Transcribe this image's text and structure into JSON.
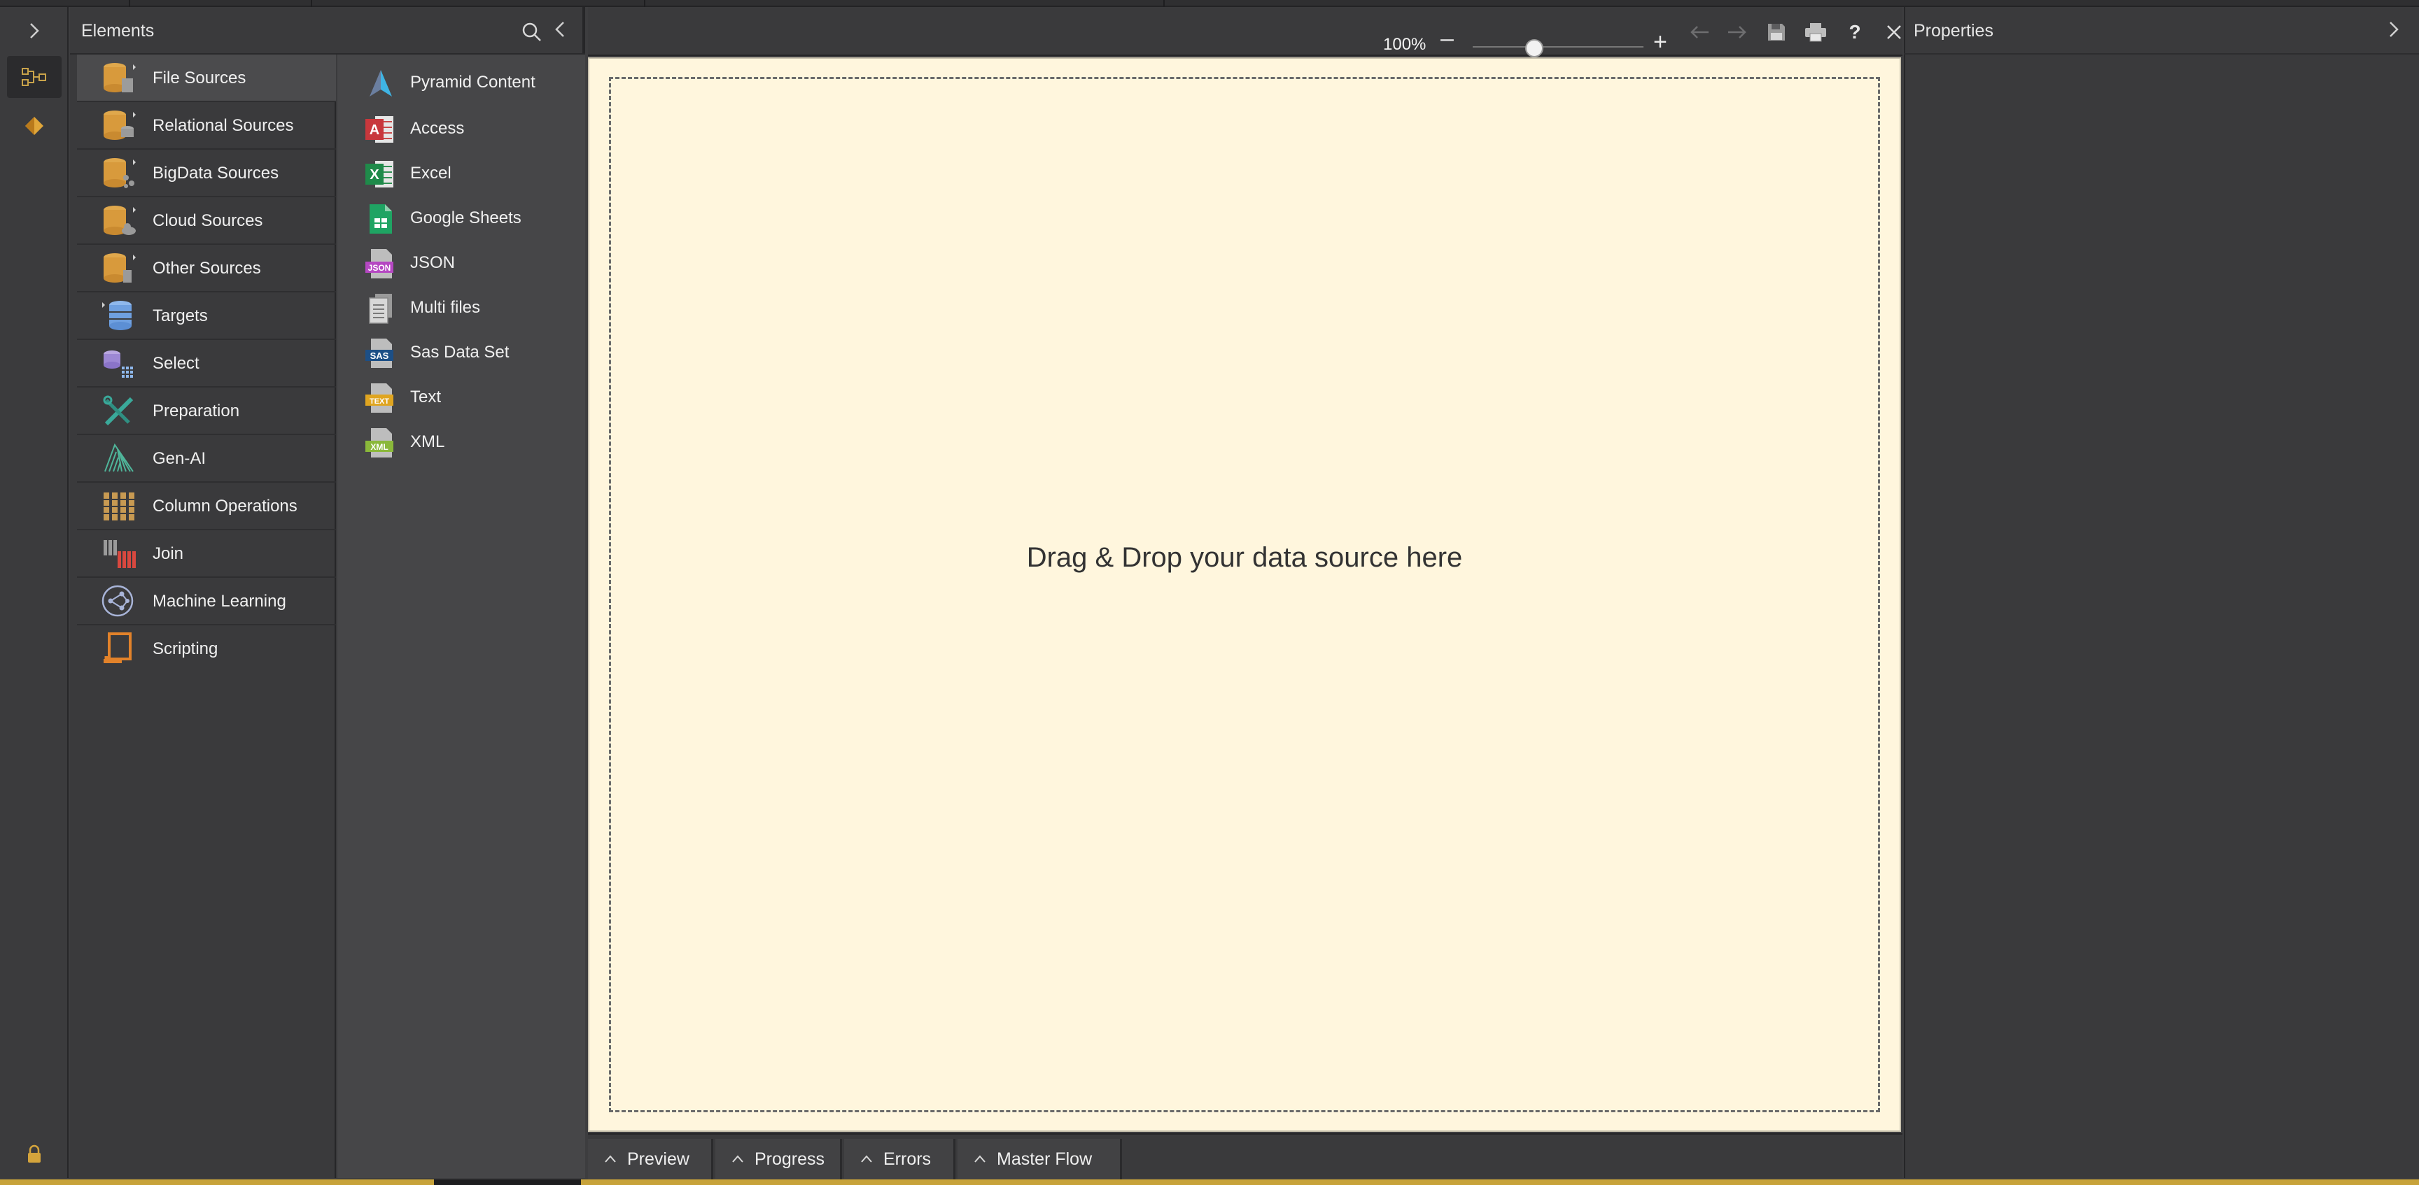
{
  "elements_panel": {
    "title": "Elements",
    "categories": [
      {
        "label": "File Sources",
        "icon": "db-file-icon"
      },
      {
        "label": "Relational Sources",
        "icon": "db-relational-icon"
      },
      {
        "label": "BigData Sources",
        "icon": "db-bigdata-icon"
      },
      {
        "label": "Cloud Sources",
        "icon": "db-cloud-icon"
      },
      {
        "label": "Other Sources",
        "icon": "db-other-icon"
      },
      {
        "label": "Targets",
        "icon": "targets-icon"
      },
      {
        "label": "Select",
        "icon": "select-icon"
      },
      {
        "label": "Preparation",
        "icon": "preparation-icon"
      },
      {
        "label": "Gen-AI",
        "icon": "gen-ai-icon"
      },
      {
        "label": "Column Operations",
        "icon": "column-operations-icon"
      },
      {
        "label": "Join",
        "icon": "join-icon"
      },
      {
        "label": "Machine Learning",
        "icon": "machine-learning-icon"
      },
      {
        "label": "Scripting",
        "icon": "scripting-icon"
      }
    ],
    "sources": [
      {
        "label": "Pyramid Content",
        "icon": "pyramid-icon"
      },
      {
        "label": "Access",
        "icon": "access-icon"
      },
      {
        "label": "Excel",
        "icon": "excel-icon"
      },
      {
        "label": "Google Sheets",
        "icon": "google-sheets-icon"
      },
      {
        "label": "JSON",
        "icon": "json-file-icon"
      },
      {
        "label": "Multi files",
        "icon": "multi-files-icon"
      },
      {
        "label": "Sas Data Set",
        "icon": "sas-file-icon"
      },
      {
        "label": "Text",
        "icon": "text-file-icon"
      },
      {
        "label": "XML",
        "icon": "xml-file-icon"
      }
    ]
  },
  "toolbar": {
    "zoom_level": "100%",
    "zoom_fraction": 0.36,
    "zoom_minus": "–",
    "zoom_plus": "+",
    "help": "?"
  },
  "canvas": {
    "drop_text": "Drag & Drop your data source here"
  },
  "bottom_tabs": [
    "Preview",
    "Progress",
    "Errors",
    "Master Flow"
  ],
  "properties": {
    "title": "Properties"
  },
  "colors": {
    "canvas_bg": "#fff6dd",
    "panel_bg": "#3a3a3c",
    "accent": "#c7a23a"
  }
}
